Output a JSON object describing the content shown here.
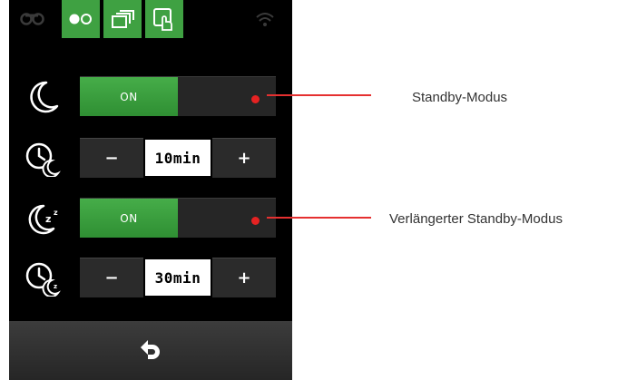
{
  "colors": {
    "accent_green": "#3fa142",
    "callout_red": "#e53030",
    "screen_bg": "#000000"
  },
  "tabs": [
    {
      "icon": "robot-mower-icon",
      "active": false
    },
    {
      "icon": "wheels-icon",
      "active": true
    },
    {
      "icon": "stacked-windows-icon",
      "active": true
    },
    {
      "icon": "touch-screen-icon",
      "active": true
    },
    {
      "icon": "wifi-icon",
      "active": false
    }
  ],
  "standby": {
    "icon": "moon-icon",
    "toggle_label": "ON"
  },
  "standby_time": {
    "icon": "clock-moon-icon",
    "minus": "−",
    "value": "10min",
    "plus": "+"
  },
  "extended_standby": {
    "icon": "moon-zzz-icon",
    "toggle_label": "ON"
  },
  "extended_time": {
    "icon": "clock-zzz-icon",
    "minus": "−",
    "value": "30min",
    "plus": "+"
  },
  "footer": {
    "icon": "back-arrow-icon"
  },
  "callouts": {
    "standby": "Standby-Modus",
    "extended": "Verlängerter Standby-Modus"
  }
}
